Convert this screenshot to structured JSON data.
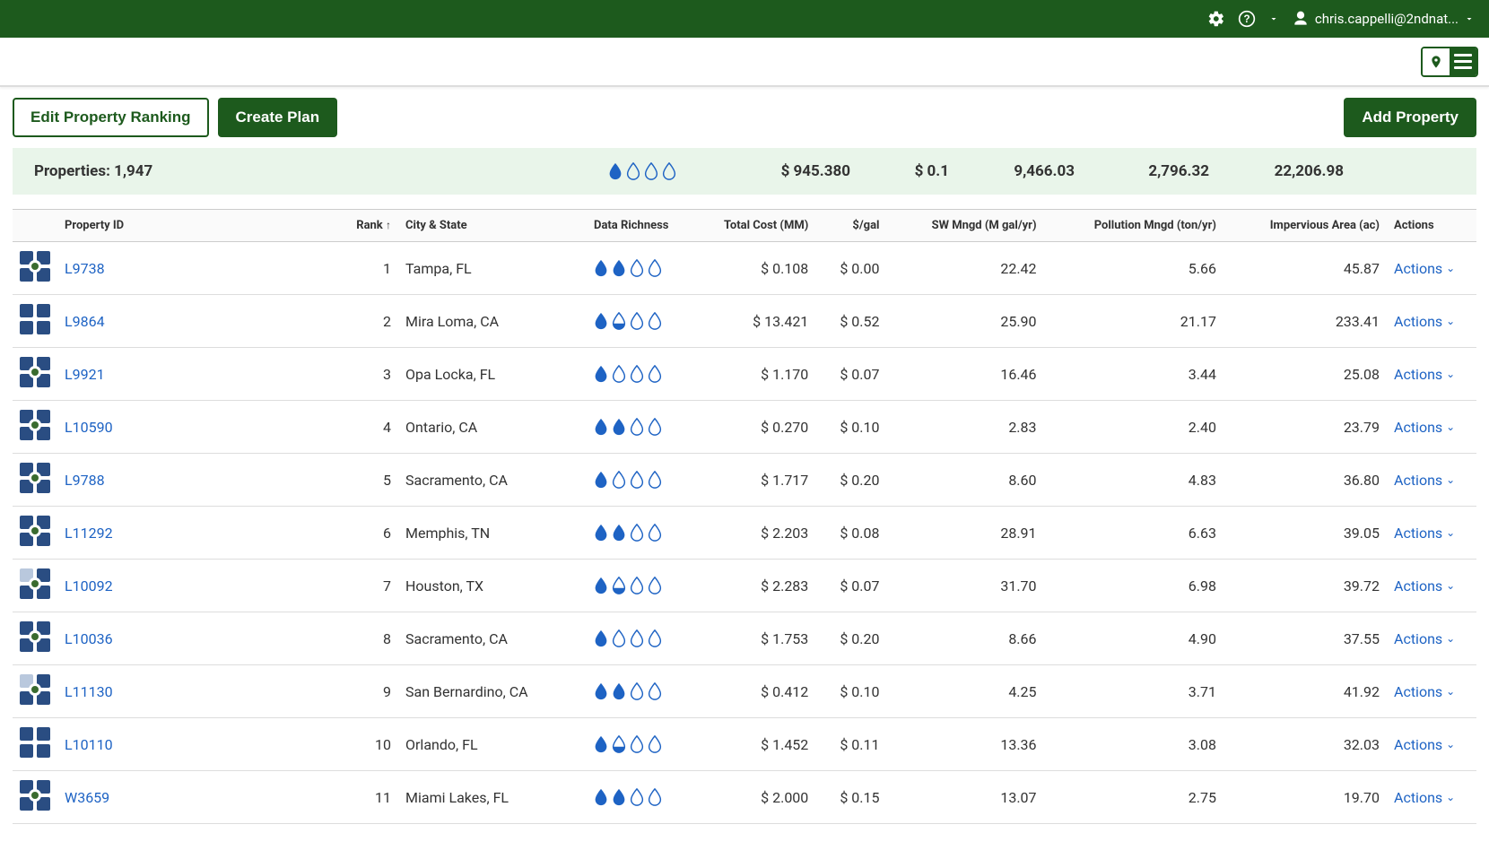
{
  "colors": {
    "brand": "#1d5a1d",
    "link": "#1e63c4",
    "drop": "#1e63c4"
  },
  "header": {
    "user_email": "chris.cappelli@2ndnat..."
  },
  "buttons": {
    "edit_ranking": "Edit Property Ranking",
    "create_plan": "Create Plan",
    "add_property": "Add Property"
  },
  "summary": {
    "label": "Properties: 1,947",
    "drops": [
      1,
      0,
      0,
      0
    ],
    "total_cost": "$ 945.380",
    "per_gal": "$ 0.1",
    "sw_mngd": "9,466.03",
    "pollution_mngd": "2,796.32",
    "impervious": "22,206.98"
  },
  "columns": {
    "property_id": "Property ID",
    "rank": "Rank",
    "city_state": "City & State",
    "data_richness": "Data Richness",
    "total_cost": "Total Cost (MM)",
    "per_gal": "$/gal",
    "sw_mngd": "SW Mngd (M gal/yr)",
    "pollution_mngd": "Pollution Mngd (ton/yr)",
    "impervious": "Impervious Area (ac)",
    "actions": "Actions"
  },
  "actions_label": "Actions",
  "rows": [
    {
      "iconLight": false,
      "iconDot": true,
      "id": "L9738",
      "rank": 1,
      "city": "Tampa, FL",
      "drops": [
        1,
        1,
        0,
        0
      ],
      "cost": "$ 0.108",
      "gal": "$ 0.00",
      "sw": "22.42",
      "pol": "5.66",
      "imp": "45.87"
    },
    {
      "iconLight": false,
      "iconDot": false,
      "id": "L9864",
      "rank": 2,
      "city": "Mira Loma, CA",
      "drops": [
        1,
        0.5,
        0,
        0
      ],
      "cost": "$ 13.421",
      "gal": "$ 0.52",
      "sw": "25.90",
      "pol": "21.17",
      "imp": "233.41"
    },
    {
      "iconLight": false,
      "iconDot": true,
      "id": "L9921",
      "rank": 3,
      "city": "Opa Locka, FL",
      "drops": [
        1,
        0,
        0,
        0
      ],
      "cost": "$ 1.170",
      "gal": "$ 0.07",
      "sw": "16.46",
      "pol": "3.44",
      "imp": "25.08"
    },
    {
      "iconLight": false,
      "iconDot": true,
      "id": "L10590",
      "rank": 4,
      "city": "Ontario, CA",
      "drops": [
        1,
        1,
        0,
        0
      ],
      "cost": "$ 0.270",
      "gal": "$ 0.10",
      "sw": "2.83",
      "pol": "2.40",
      "imp": "23.79"
    },
    {
      "iconLight": false,
      "iconDot": true,
      "id": "L9788",
      "rank": 5,
      "city": "Sacramento, CA",
      "drops": [
        1,
        0,
        0,
        0
      ],
      "cost": "$ 1.717",
      "gal": "$ 0.20",
      "sw": "8.60",
      "pol": "4.83",
      "imp": "36.80"
    },
    {
      "iconLight": false,
      "iconDot": true,
      "id": "L11292",
      "rank": 6,
      "city": "Memphis, TN",
      "drops": [
        1,
        1,
        0,
        0
      ],
      "cost": "$ 2.203",
      "gal": "$ 0.08",
      "sw": "28.91",
      "pol": "6.63",
      "imp": "39.05"
    },
    {
      "iconLight": true,
      "iconDot": true,
      "id": "L10092",
      "rank": 7,
      "city": "Houston, TX",
      "drops": [
        1,
        0.5,
        0,
        0
      ],
      "cost": "$ 2.283",
      "gal": "$ 0.07",
      "sw": "31.70",
      "pol": "6.98",
      "imp": "39.72"
    },
    {
      "iconLight": false,
      "iconDot": true,
      "id": "L10036",
      "rank": 8,
      "city": "Sacramento, CA",
      "drops": [
        1,
        0,
        0,
        0
      ],
      "cost": "$ 1.753",
      "gal": "$ 0.20",
      "sw": "8.66",
      "pol": "4.90",
      "imp": "37.55"
    },
    {
      "iconLight": true,
      "iconDot": true,
      "id": "L11130",
      "rank": 9,
      "city": "San Bernardino, CA",
      "drops": [
        1,
        1,
        0,
        0
      ],
      "cost": "$ 0.412",
      "gal": "$ 0.10",
      "sw": "4.25",
      "pol": "3.71",
      "imp": "41.92"
    },
    {
      "iconLight": false,
      "iconDot": false,
      "id": "L10110",
      "rank": 10,
      "city": "Orlando, FL",
      "drops": [
        1,
        0.5,
        0,
        0
      ],
      "cost": "$ 1.452",
      "gal": "$ 0.11",
      "sw": "13.36",
      "pol": "3.08",
      "imp": "32.03"
    },
    {
      "iconLight": false,
      "iconDot": true,
      "id": "W3659",
      "rank": 11,
      "city": "Miami Lakes, FL",
      "drops": [
        1,
        1,
        0,
        0
      ],
      "cost": "$ 2.000",
      "gal": "$ 0.15",
      "sw": "13.07",
      "pol": "2.75",
      "imp": "19.70"
    }
  ]
}
